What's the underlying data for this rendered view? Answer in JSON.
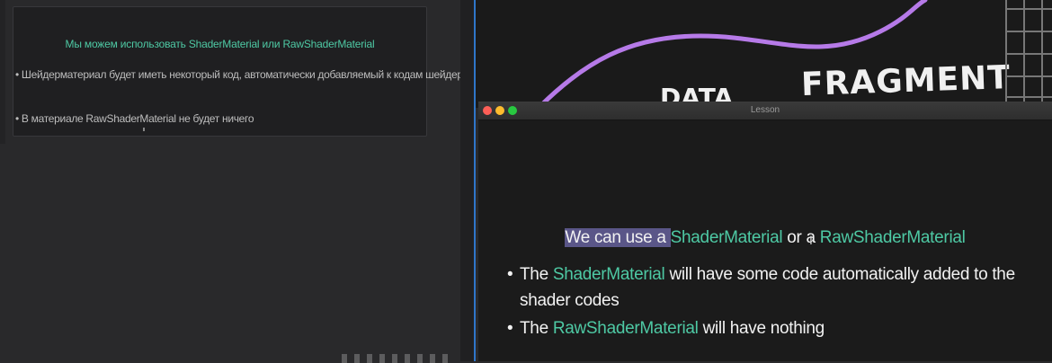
{
  "notes": {
    "title": "Мы можем использовать ShaderMaterial или RawShaderMaterial",
    "bullets": [
      "• Шейдерматериал будет иметь некоторый код, автоматически добавляемый к кодам шейдеров",
      "• В материале RawShaderMaterial не будет ничего"
    ]
  },
  "video": {
    "sketch_word": "FRAGMENT",
    "sketch_word_partial": "DATA"
  },
  "lesson_window": {
    "title": "Lesson",
    "heading": {
      "highlighted": "We can use a ",
      "accent1": "ShaderMaterial",
      "middle": " or a ",
      "accent2": "RawShaderMaterial"
    },
    "bullets": [
      {
        "prefix": "The ",
        "accent": "ShaderMaterial",
        "suffix": " will have some code automatically added to the shader codes"
      },
      {
        "prefix": "The ",
        "accent": "RawShaderMaterial",
        "suffix": " will have nothing"
      }
    ]
  },
  "colors": {
    "accent": "#4ec9a4",
    "highlight": "#5a5688",
    "curve": "#b67ae8",
    "divider": "#2f76c9"
  }
}
